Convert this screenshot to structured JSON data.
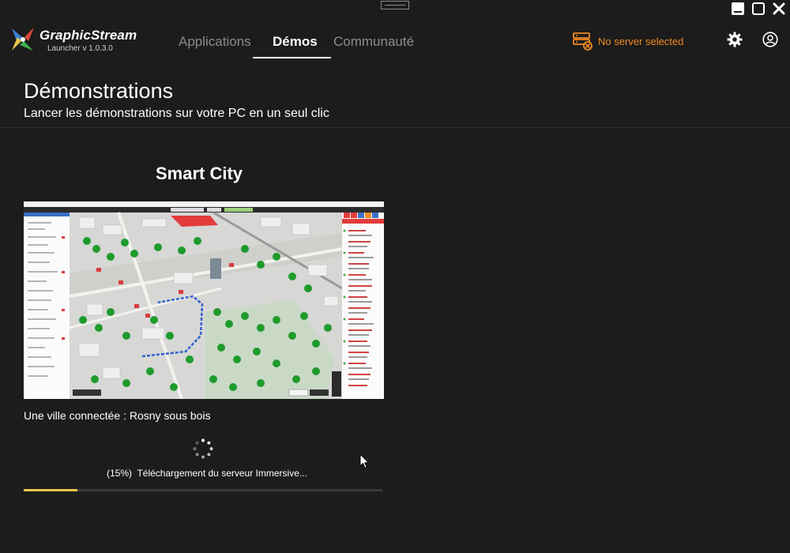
{
  "app": {
    "name": "GraphicStream",
    "version": "Launcher v 1.0.3.0"
  },
  "nav": {
    "tabs": [
      {
        "label": "Applications",
        "active": false
      },
      {
        "label": "Démos",
        "active": true
      },
      {
        "label": "Communauté",
        "active": false
      }
    ]
  },
  "header": {
    "server_status": "No server selected",
    "icons": [
      "server-error-icon",
      "gear-icon",
      "user-icon"
    ]
  },
  "page": {
    "title": "Démonstrations",
    "subtitle": "Lancer les démonstrations sur votre PC en un seul clic"
  },
  "demo": {
    "title": "Smart City",
    "description": "Une ville connectée : Rosny sous bois",
    "progress_text": "(15%)  Téléchargement du serveur Immersive...",
    "progress_fraction": 0.15
  },
  "colors": {
    "background": "#1c1c1c",
    "accent_orange": "#f08a24",
    "progress": "#e8c64a"
  }
}
